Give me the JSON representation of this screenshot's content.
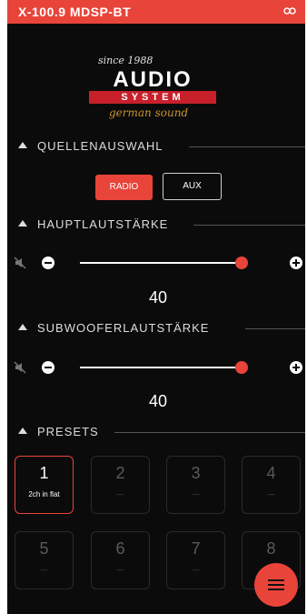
{
  "app": {
    "title": "X-100.9 MDSP-BT",
    "link_icon": "link-icon"
  },
  "logo": {
    "since": "since 1988",
    "brand": "AUDIO",
    "system": "SYSTEM",
    "tagline": "german sound"
  },
  "sections": {
    "source": {
      "label": "QUELLENAUSWAHL"
    },
    "main_volume": {
      "label": "HAUPTLAUTSTÄRKE"
    },
    "sub_volume": {
      "label": "SUBWOOFERLAUTSTÄRKE"
    },
    "presets": {
      "label": "PRESETS"
    }
  },
  "source": {
    "options": [
      "RADIO",
      "AUX"
    ],
    "selected": "RADIO"
  },
  "main_volume": {
    "value": "40",
    "level": 1.0
  },
  "sub_volume": {
    "value": "40",
    "level": 1.0
  },
  "presets": [
    {
      "number": "1",
      "name": "2ch in flat",
      "active": true
    },
    {
      "number": "2",
      "name": "—",
      "active": false
    },
    {
      "number": "3",
      "name": "—",
      "active": false
    },
    {
      "number": "4",
      "name": "—",
      "active": false
    },
    {
      "number": "5",
      "name": "—",
      "active": false
    },
    {
      "number": "6",
      "name": "—",
      "active": false
    },
    {
      "number": "7",
      "name": "—",
      "active": false
    },
    {
      "number": "8",
      "name": "—",
      "active": false
    }
  ],
  "colors": {
    "accent": "#e9443a",
    "background": "#0b0b0b",
    "gold": "#c8952d"
  }
}
